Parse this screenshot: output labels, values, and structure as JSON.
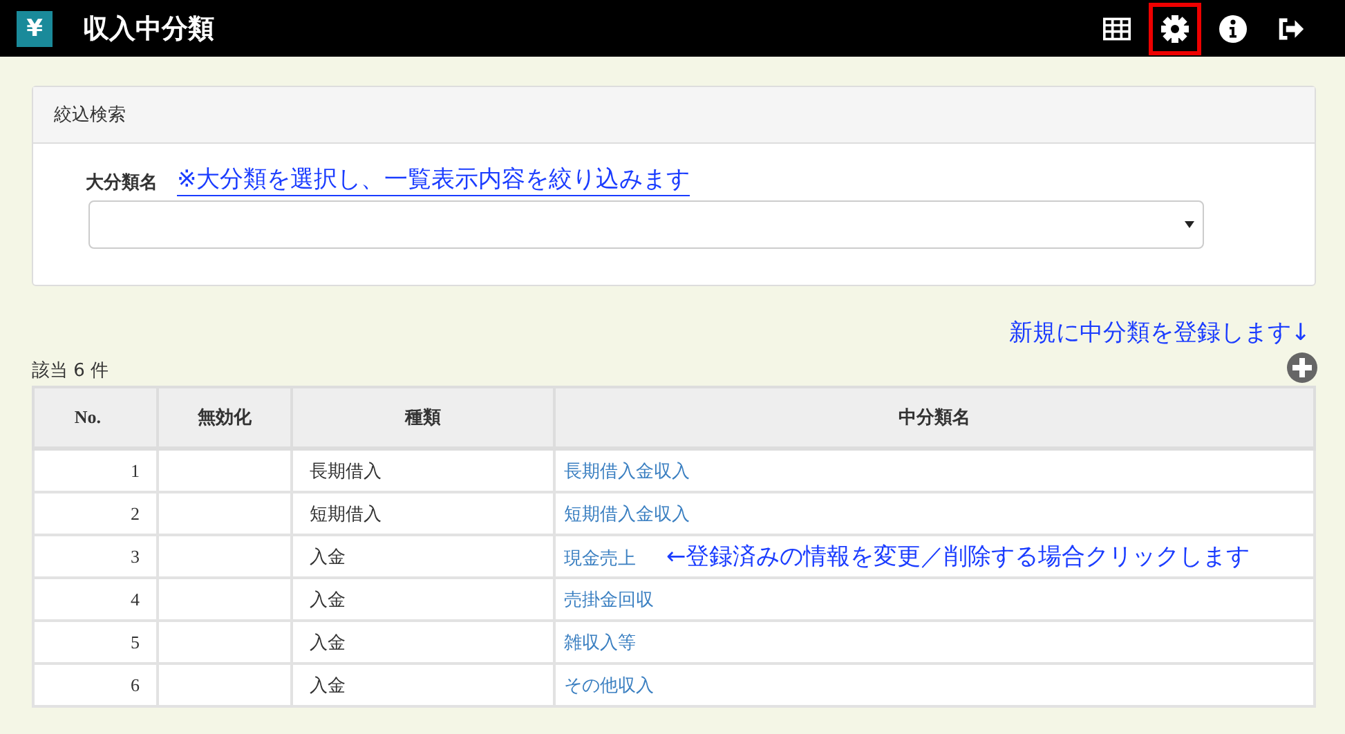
{
  "header": {
    "logo": "¥",
    "title": "収入中分類",
    "tools": [
      {
        "kind": "grid",
        "highlighted": false
      },
      {
        "kind": "gear",
        "highlighted": true
      },
      {
        "kind": "info",
        "highlighted": false
      },
      {
        "kind": "logout",
        "highlighted": false
      }
    ]
  },
  "search_panel": {
    "title": "絞込検索",
    "field_label": "大分類名",
    "note": "※大分類を選択し、一覧表示内容を絞り込みます"
  },
  "add_note": "新規に中分類を登録します↓",
  "count": "該当 6 件",
  "table": {
    "columns": [
      "No.",
      "無効化",
      "種類",
      "中分類名"
    ],
    "rows": [
      {
        "no": "1",
        "kind": "長期借入",
        "name": "長期借入金収入"
      },
      {
        "no": "2",
        "kind": "短期借入",
        "name": "短期借入金収入"
      },
      {
        "no": "3",
        "kind": "入金",
        "name": "現金売上",
        "note": "←登録済みの情報を変更／削除する場合クリックします"
      },
      {
        "no": "4",
        "kind": "入金",
        "name": "売掛金回収"
      },
      {
        "no": "5",
        "kind": "入金",
        "name": "雑収入等"
      },
      {
        "no": "6",
        "kind": "入金",
        "name": "その他収入"
      }
    ]
  }
}
